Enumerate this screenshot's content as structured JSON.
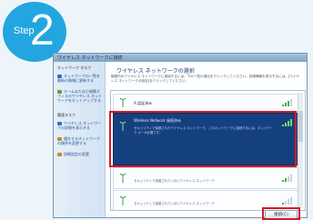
{
  "step_badge": {
    "word": "Step",
    "number": "2",
    "color": "#23a6e0"
  },
  "window": {
    "title": "ワイヤレス ネットワークに接続"
  },
  "sidebar": {
    "sections": [
      {
        "heading": "ネットワーク タスク",
        "items": [
          {
            "label": "ネットワークの一覧を最新の情報に更新する",
            "icon": "refresh-icon"
          },
          {
            "label": "ホームまたは小規模オフィスのワイヤレス ネットワークをセットアップする",
            "icon": "setup-icon"
          }
        ]
      },
      {
        "heading": "関連タスク",
        "items": [
          {
            "label": "ワイヤレス ネットワークの詳細を表示する",
            "icon": "info-icon"
          },
          {
            "label": "優先するネットワークの順序を変更する",
            "icon": "star-icon"
          },
          {
            "label": "詳細設定の変更",
            "icon": "settings-icon"
          }
        ]
      }
    ]
  },
  "content": {
    "title": "ワイヤレス ネットワークの選択",
    "description": "範囲内のワイヤレス ネットワークに接続するには、下の一覧の項目をクリックしてください。詳細情報を表示するには、[ワイヤレス ネットワークの設定]をクリックしてください。"
  },
  "networks": [
    {
      "name": "A 認証済み",
      "detail": "",
      "selected": false
    },
    {
      "name": "Wireless Network 接続済み",
      "detail": "セキュリティで保護されたワイヤレス ネットワーク。このネットワークに接続するには、ネットワーク キーが必要です。",
      "selected": true
    },
    {
      "name": "",
      "detail": "セキュリティで保護されていないワイヤレス ネットワーク",
      "selected": false
    },
    {
      "name": "",
      "detail": "セキュリティで保護されていないワイヤレス ネットワーク",
      "selected": false
    }
  ],
  "connect_button": {
    "label": "接続(C)"
  },
  "colors": {
    "highlight": "#d11c28",
    "selected_row": "#15407f",
    "link": "#1e4f98"
  }
}
